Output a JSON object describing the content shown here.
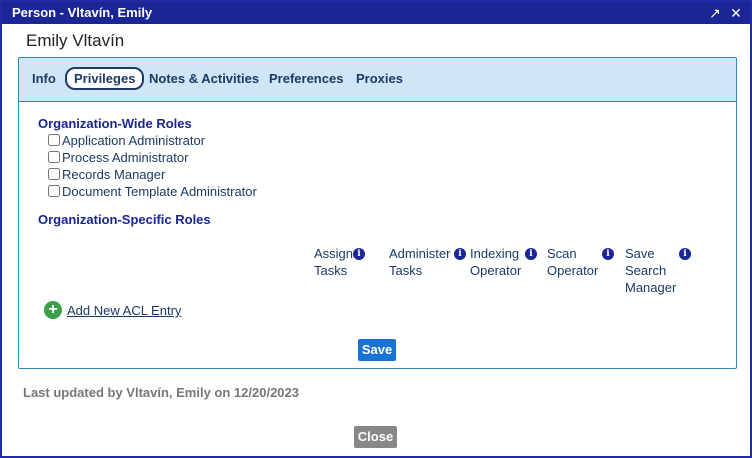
{
  "window": {
    "title": "Person - Vltavín, Emily"
  },
  "person": {
    "name": "Emily Vltavín"
  },
  "tabs": [
    {
      "label": "Info"
    },
    {
      "label": "Privileges"
    },
    {
      "label": "Notes & Activities"
    },
    {
      "label": "Preferences"
    },
    {
      "label": "Proxies"
    }
  ],
  "org_wide": {
    "heading": "Organization-Wide Roles",
    "roles": [
      {
        "label": "Application Administrator",
        "checked": false
      },
      {
        "label": "Process Administrator",
        "checked": false
      },
      {
        "label": "Records Manager",
        "checked": false
      },
      {
        "label": "Document Template Administrator",
        "checked": false
      }
    ]
  },
  "org_specific": {
    "heading": "Organization-Specific Roles",
    "columns": [
      {
        "line1": "Assign",
        "line2": "Tasks",
        "line3": ""
      },
      {
        "line1": "Administer",
        "line2": "Tasks",
        "line3": ""
      },
      {
        "line1": "Indexing",
        "line2": "Operator",
        "line3": ""
      },
      {
        "line1": "Scan",
        "line2": "Operator",
        "line3": ""
      },
      {
        "line1": "Save",
        "line2": "Search",
        "line3": "Manager"
      }
    ],
    "info_glyph": "i",
    "add_link": "Add New ACL Entry"
  },
  "buttons": {
    "save": "Save",
    "close": "Close"
  },
  "footer": {
    "last_updated": "Last updated by Vltavín, Emily on 12/20/2023"
  },
  "icons": {
    "popout": "popout-icon",
    "close": "close-icon",
    "info": "info-icon",
    "add": "plus-circle-icon"
  }
}
